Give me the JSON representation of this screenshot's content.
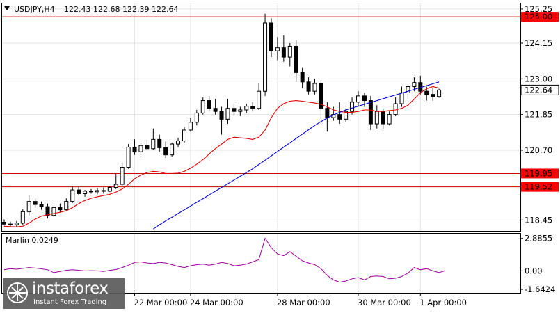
{
  "header": {
    "symbol": "USDJPY,H4",
    "ohlc": "122.43 122.68 122.39 122.64"
  },
  "indicator": {
    "label": "Marlin 0.0249"
  },
  "logo": {
    "name": "instaforex",
    "tagline": "Instant Forex Trading"
  },
  "colors": {
    "level_line": "#cc0000",
    "ma_fast": "#dd0000",
    "ma_slow": "#0000cc",
    "oscillator": "#990099",
    "grid": "#e3e3e3",
    "price_badge": "#ffffff",
    "level_badge": "#ff0000"
  },
  "price_axis": {
    "ticks": [
      "125.25",
      "124.15",
      "123.00",
      "121.85",
      "120.70",
      "118.45"
    ],
    "levels": [
      {
        "label": "125.00",
        "value": 125.0
      },
      {
        "label": "119.95",
        "value": 119.95
      },
      {
        "label": "119.52",
        "value": 119.52
      }
    ],
    "current": {
      "label": "122.64",
      "value": 122.64
    }
  },
  "osc_axis": {
    "ticks": [
      "2.8855",
      "0.00",
      "-1.6424"
    ]
  },
  "time_axis": {
    "labels": [
      "22 Mar 00:00",
      "24 Mar 00:00",
      "28 Mar 00:00",
      "30 Mar 00:00",
      "1 Apr 00:00"
    ]
  },
  "chart_data": {
    "type": "candlestick",
    "symbol": "USDJPY",
    "timeframe": "H4",
    "ylim": [
      118.1,
      125.45
    ],
    "osc_ylim": [
      -1.95,
      3.3
    ],
    "candles": [
      [
        118.38,
        118.47,
        118.28,
        118.32
      ],
      [
        118.32,
        118.4,
        118.25,
        118.3
      ],
      [
        118.3,
        118.42,
        118.22,
        118.35
      ],
      [
        118.35,
        118.8,
        118.3,
        118.72
      ],
      [
        118.72,
        119.25,
        118.6,
        119.05
      ],
      [
        119.05,
        119.15,
        118.85,
        118.95
      ],
      [
        118.95,
        119.05,
        118.78,
        118.88
      ],
      [
        118.88,
        118.98,
        118.5,
        118.6
      ],
      [
        118.6,
        118.92,
        118.55,
        118.85
      ],
      [
        118.85,
        118.98,
        118.7,
        118.78
      ],
      [
        118.78,
        119.15,
        118.75,
        119.05
      ],
      [
        119.05,
        119.52,
        119.0,
        119.42
      ],
      [
        119.42,
        119.55,
        119.25,
        119.3
      ],
      [
        119.3,
        119.42,
        119.2,
        119.38
      ],
      [
        119.38,
        119.45,
        119.3,
        119.36
      ],
      [
        119.36,
        119.48,
        119.28,
        119.4
      ],
      [
        119.4,
        119.5,
        119.3,
        119.38
      ],
      [
        119.38,
        119.55,
        119.35,
        119.5
      ],
      [
        119.5,
        119.95,
        119.45,
        119.6
      ],
      [
        119.6,
        120.3,
        119.55,
        120.15
      ],
      [
        120.15,
        120.9,
        120.1,
        120.8
      ],
      [
        120.8,
        121.05,
        120.55,
        120.65
      ],
      [
        120.65,
        120.92,
        120.45,
        120.85
      ],
      [
        120.85,
        121.05,
        120.7,
        120.75
      ],
      [
        120.75,
        121.4,
        120.7,
        121.05
      ],
      [
        121.05,
        121.2,
        120.65,
        120.78
      ],
      [
        120.78,
        120.98,
        120.45,
        120.55
      ],
      [
        120.55,
        120.95,
        120.5,
        120.9
      ],
      [
        120.9,
        121.1,
        120.8,
        121.0
      ],
      [
        121.0,
        121.45,
        120.95,
        121.35
      ],
      [
        121.35,
        121.75,
        121.3,
        121.6
      ],
      [
        121.6,
        122.0,
        121.5,
        121.9
      ],
      [
        121.9,
        122.4,
        121.85,
        122.3
      ],
      [
        122.3,
        122.45,
        121.95,
        122.05
      ],
      [
        122.05,
        122.35,
        121.85,
        121.95
      ],
      [
        121.95,
        122.1,
        121.2,
        121.7
      ],
      [
        121.7,
        122.35,
        121.55,
        122.05
      ],
      [
        122.05,
        122.2,
        121.8,
        121.95
      ],
      [
        121.95,
        122.1,
        121.8,
        122.0
      ],
      [
        122.0,
        122.2,
        121.9,
        122.12
      ],
      [
        122.12,
        122.25,
        121.95,
        122.05
      ],
      [
        122.05,
        122.85,
        122.0,
        122.6
      ],
      [
        122.6,
        125.1,
        122.45,
        124.8
      ],
      [
        124.8,
        124.95,
        123.7,
        123.9
      ],
      [
        123.9,
        124.35,
        123.6,
        124.0
      ],
      [
        124.0,
        124.4,
        123.55,
        123.7
      ],
      [
        123.7,
        124.15,
        123.4,
        124.05
      ],
      [
        124.05,
        124.25,
        122.9,
        123.2
      ],
      [
        123.2,
        123.35,
        122.7,
        122.9
      ],
      [
        122.9,
        123.05,
        122.5,
        122.6
      ],
      [
        122.6,
        123.0,
        122.5,
        122.85
      ],
      [
        122.85,
        122.95,
        121.7,
        122.05
      ],
      [
        122.05,
        122.25,
        121.3,
        121.75
      ],
      [
        121.75,
        122.1,
        121.65,
        121.85
      ],
      [
        121.85,
        122.25,
        121.55,
        121.7
      ],
      [
        121.7,
        122.05,
        121.6,
        121.95
      ],
      [
        121.95,
        122.4,
        121.85,
        122.25
      ],
      [
        122.25,
        122.6,
        122.1,
        122.45
      ],
      [
        122.45,
        122.55,
        122.1,
        122.3
      ],
      [
        122.3,
        122.45,
        121.35,
        121.55
      ],
      [
        121.55,
        122.15,
        121.4,
        121.95
      ],
      [
        121.95,
        122.05,
        121.4,
        121.55
      ],
      [
        121.55,
        121.95,
        121.5,
        121.85
      ],
      [
        121.85,
        122.4,
        121.8,
        122.2
      ],
      [
        122.2,
        122.75,
        122.1,
        122.55
      ],
      [
        122.55,
        122.85,
        122.35,
        122.75
      ],
      [
        122.75,
        123.05,
        122.6,
        122.88
      ],
      [
        122.88,
        123.1,
        122.5,
        122.6
      ],
      [
        122.6,
        122.75,
        122.3,
        122.5
      ],
      [
        122.5,
        122.7,
        122.3,
        122.43
      ],
      [
        122.43,
        122.68,
        122.39,
        122.64
      ]
    ],
    "series": [
      {
        "values": [
          118.25,
          118.24,
          118.23,
          118.25,
          118.35,
          118.48,
          118.58,
          118.62,
          118.66,
          118.7,
          118.75,
          118.85,
          118.98,
          119.08,
          119.15,
          119.2,
          119.24,
          119.28,
          119.35,
          119.45,
          119.6,
          119.78,
          119.9,
          119.98,
          120.02,
          120.0,
          119.95,
          119.95,
          119.96,
          120.02,
          120.12,
          120.25,
          120.4,
          120.58,
          120.75,
          120.9,
          121.05,
          121.12,
          121.1,
          121.08,
          121.05,
          121.12,
          121.35,
          121.75,
          122.05,
          122.2,
          122.28,
          122.3,
          122.28,
          122.25,
          122.22,
          122.18,
          122.1,
          122.0,
          121.95,
          121.92,
          121.92,
          121.95,
          122.0,
          122.0,
          121.95,
          121.95,
          121.98,
          122.0,
          122.05,
          122.15,
          122.35,
          122.55,
          122.68,
          122.75,
          122.7
        ]
      },
      {
        "start": 21,
        "values": [
          117.72,
          117.88,
          118.02,
          118.16,
          118.3,
          118.42,
          118.54,
          118.66,
          118.78,
          118.9,
          119.02,
          119.14,
          119.26,
          119.38,
          119.5,
          119.62,
          119.74,
          119.86,
          119.98,
          120.1,
          120.24,
          120.38,
          120.52,
          120.66,
          120.8,
          120.94,
          121.08,
          121.22,
          121.36,
          121.5,
          121.62,
          121.74,
          121.84,
          121.92,
          122.0,
          122.06,
          122.12,
          122.18,
          122.24,
          122.3,
          122.36,
          122.42,
          122.48,
          122.54,
          122.6,
          122.66,
          122.72,
          122.78,
          122.84,
          122.9
        ]
      }
    ],
    "oscillator": {
      "name": "Marlin",
      "value": 0.0249,
      "values": [
        0.1,
        0.2,
        0.15,
        0.22,
        0.3,
        0.25,
        0.18,
        0.1,
        -0.15,
        -0.05,
        0.05,
        0.1,
        0.05,
        0.0,
        0.02,
        0.0,
        -0.05,
        0.05,
        0.12,
        0.3,
        0.5,
        0.75,
        0.8,
        0.7,
        0.65,
        0.75,
        0.7,
        0.55,
        0.4,
        0.3,
        0.45,
        0.55,
        0.6,
        0.5,
        0.6,
        0.75,
        0.65,
        0.45,
        0.5,
        0.6,
        0.8,
        1.0,
        2.89,
        2.05,
        1.5,
        1.35,
        1.7,
        1.3,
        0.9,
        0.7,
        0.55,
        0.2,
        -0.4,
        -0.8,
        -1.0,
        -0.9,
        -0.7,
        -0.6,
        -0.8,
        -0.5,
        -0.45,
        -0.5,
        -0.7,
        -0.65,
        -0.5,
        -0.2,
        0.3,
        0.1,
        0.2,
        0.0,
        -0.15,
        0.02
      ]
    }
  }
}
